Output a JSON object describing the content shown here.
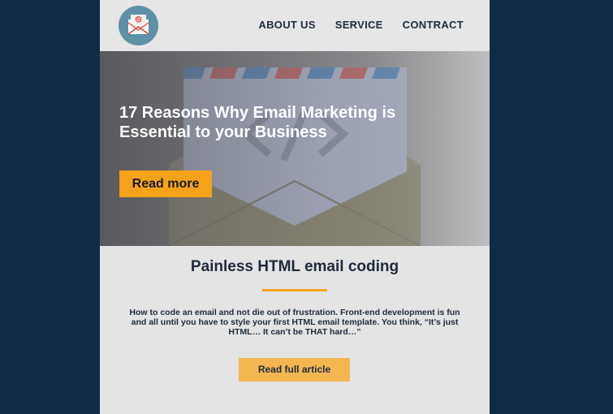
{
  "header": {
    "logo_icon": "email-at-icon",
    "nav": [
      {
        "label": "ABOUT US"
      },
      {
        "label": "SERVICE"
      },
      {
        "label": "CONTRACT"
      }
    ]
  },
  "hero": {
    "title": "17 Reasons Why Email Marketing is Essential to your Business",
    "button_label": "Read more",
    "background_icon": "code-envelope-icon"
  },
  "article": {
    "title": "Painless HTML email coding",
    "body": "How to code an email and not die out of frustration. Front-end development is fun and all until you have to style your first HTML email template. You think, “It’s just HTML… It can’t be THAT hard…”",
    "button_label": "Read full article"
  },
  "colors": {
    "page_background": "#102a47",
    "accent": "#f5a31a",
    "text_dark": "#1d2a3c"
  }
}
